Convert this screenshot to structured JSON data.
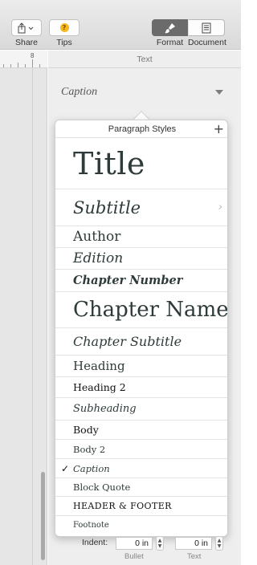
{
  "toolbar": {
    "share_label": "Share",
    "tips_label": "Tips",
    "format_label": "Format",
    "document_label": "Document"
  },
  "ruler": {
    "number": "8"
  },
  "inspector": {
    "tab_label": "Text",
    "current_style": "Caption"
  },
  "popover": {
    "title": "Paragraph Styles",
    "add_symbol": "+",
    "styles": [
      {
        "label": "Title"
      },
      {
        "label": "Subtitle"
      },
      {
        "label": "Author"
      },
      {
        "label": "Edition"
      },
      {
        "label": "Chapter Number"
      },
      {
        "label": "Chapter Name"
      },
      {
        "label": "Chapter Subtitle"
      },
      {
        "label": "Heading"
      },
      {
        "label": "Heading 2"
      },
      {
        "label": "Subheading"
      },
      {
        "label": "Body"
      },
      {
        "label": "Body 2"
      },
      {
        "label": "Caption"
      },
      {
        "label": "Block Quote"
      },
      {
        "label": "HEADER & FOOTER"
      },
      {
        "label": "Footnote"
      }
    ],
    "selected_index": 12
  },
  "indent": {
    "label": "Indent:",
    "bullet_value": "0 in",
    "text_value": "0 in",
    "bullet_label": "Bullet",
    "text_label": "Text"
  },
  "colors": {
    "toolbar_bg": "#dcdcdc",
    "active_segment": "#6b6b6b",
    "tips_badge": "#f7b81c",
    "style_text": "#2e3b3a"
  }
}
